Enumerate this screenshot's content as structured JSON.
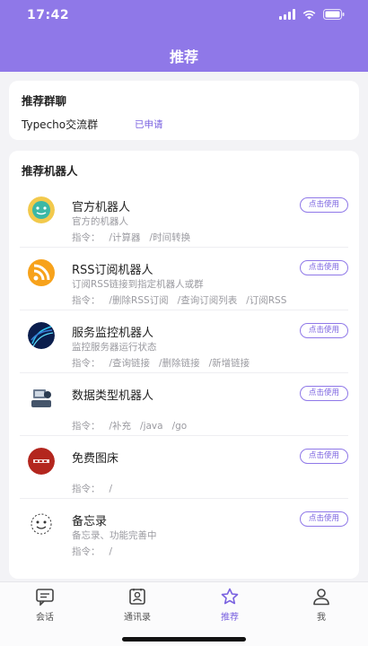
{
  "status_bar": {
    "time": "17:42"
  },
  "header": {
    "title": "推荐"
  },
  "group_section": {
    "title": "推荐群聊",
    "group_name": "Typecho交流群",
    "group_status": "已申请"
  },
  "bots_section": {
    "title": "推荐机器人",
    "use_label": "点击使用",
    "bots": [
      {
        "name": "官方机器人",
        "desc": "官方的机器人",
        "cmd_prefix": "指令：",
        "cmds": [
          "/计算器",
          "/时间转换"
        ],
        "icon": "smiley-bot-icon"
      },
      {
        "name": "RSS订阅机器人",
        "desc": "订阅RSS链接到指定机器人或群",
        "cmd_prefix": "指令：",
        "cmds": [
          "/删除RSS订阅",
          "/查询订阅列表",
          "/订阅RSS"
        ],
        "icon": "rss-icon"
      },
      {
        "name": "服务监控机器人",
        "desc": "监控服务器运行状态",
        "cmd_prefix": "指令：",
        "cmds": [
          "/查询链接",
          "/删除链接",
          "/新增链接"
        ],
        "icon": "server-monitor-icon"
      },
      {
        "name": "数据类型机器人",
        "desc": "",
        "cmd_prefix": "指令：",
        "cmds": [
          "/补充",
          "/java",
          "/go"
        ],
        "icon": "data-type-icon"
      },
      {
        "name": "免费图床",
        "desc": "",
        "cmd_prefix": "指令：",
        "cmds": [
          "/"
        ],
        "icon": "image-host-icon"
      },
      {
        "name": "备忘录",
        "desc": "备忘录、功能完善中",
        "cmd_prefix": "指令：",
        "cmds": [
          "/"
        ],
        "icon": "memo-icon"
      }
    ]
  },
  "tabbar": {
    "tabs": [
      {
        "label": "会话",
        "icon": "chat-icon"
      },
      {
        "label": "通讯录",
        "icon": "contacts-icon"
      },
      {
        "label": "推荐",
        "icon": "star-icon",
        "active": true
      },
      {
        "label": "我",
        "icon": "user-icon"
      }
    ]
  },
  "colors": {
    "accent": "#8f78e8",
    "accent_text": "#7a62e0"
  }
}
